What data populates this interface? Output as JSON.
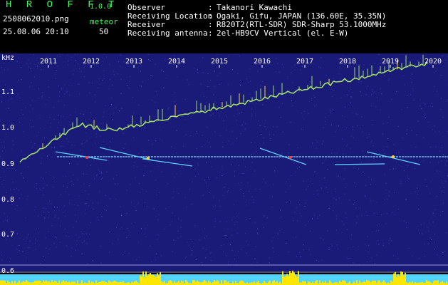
{
  "header": {
    "brand": "H R O F F T",
    "version": "1.0.0",
    "filename": "2508062010.png",
    "timestamp": "25.08.06 20:10",
    "mode": "meteor",
    "count": "50"
  },
  "station": [
    {
      "key": "Observer",
      "value": "Takanori Kawachi"
    },
    {
      "key": "Receiving Location",
      "value": "Ogaki, Gifu, JAPAN (136.60E, 35.35N)"
    },
    {
      "key": "Receiver",
      "value": "R820T2(RTL-SDR) SDR-Sharp 53.1000MHz"
    },
    {
      "key": "Receiving antenna",
      "value": "2el-HB9CV Vertical (el. E-W)"
    }
  ],
  "plot": {
    "unit": "kHz",
    "y_ticks": [
      "1.1",
      "1.0",
      "0.9",
      "0.8",
      "0.7",
      "0.6"
    ],
    "year_ticks": [
      "2011",
      "2012",
      "2013",
      "2014",
      "2015",
      "2016",
      "2017",
      "2018",
      "2019",
      "2020"
    ],
    "colors": {
      "background": "#1a1a78",
      "noise": "#3b3bb0",
      "trace": "#9fdc6a",
      "hot": "#ffd23c",
      "sat": "#ff3b3b",
      "bar": "#ffe600",
      "baseline": "#4fd3ff"
    }
  }
}
